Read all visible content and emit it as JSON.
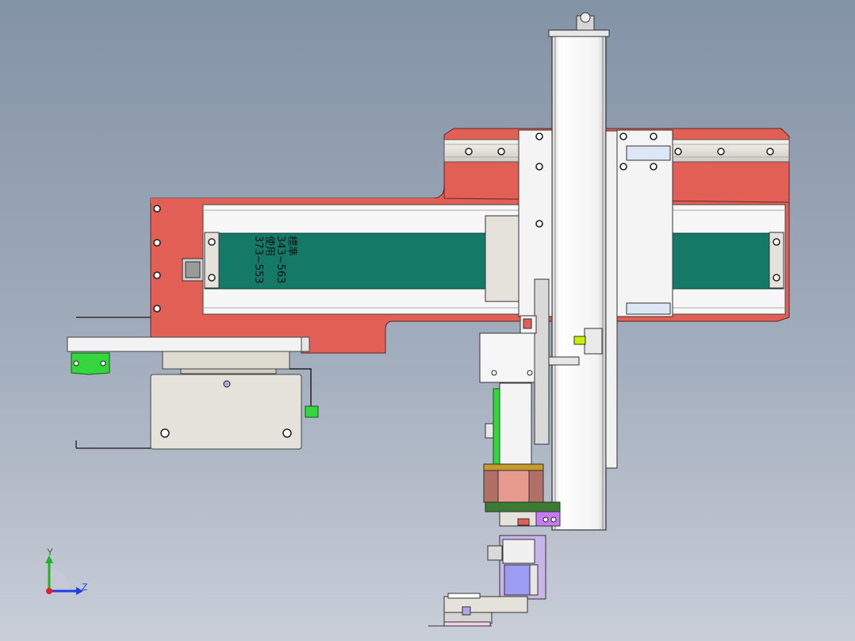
{
  "annotation": {
    "line1": "標準",
    "line2": "343~563",
    "line3": "使用",
    "line4": "373~553"
  },
  "triad": {
    "y_label": "Y",
    "z_label": "Z"
  },
  "colors": {
    "background_top": "#8393a6",
    "background_bottom": "#c9ced8",
    "frame_red": "#e25f55",
    "belt_green": "#147a67",
    "column_white": "#f7f7f7",
    "bracket_gray": "#e4e2da",
    "gearbox_salmon": "#e79a8e",
    "gripper_lavender": "#c9b6e8",
    "cylinder_blue": "#9b9cf2",
    "rail_green": "#35d63d"
  }
}
